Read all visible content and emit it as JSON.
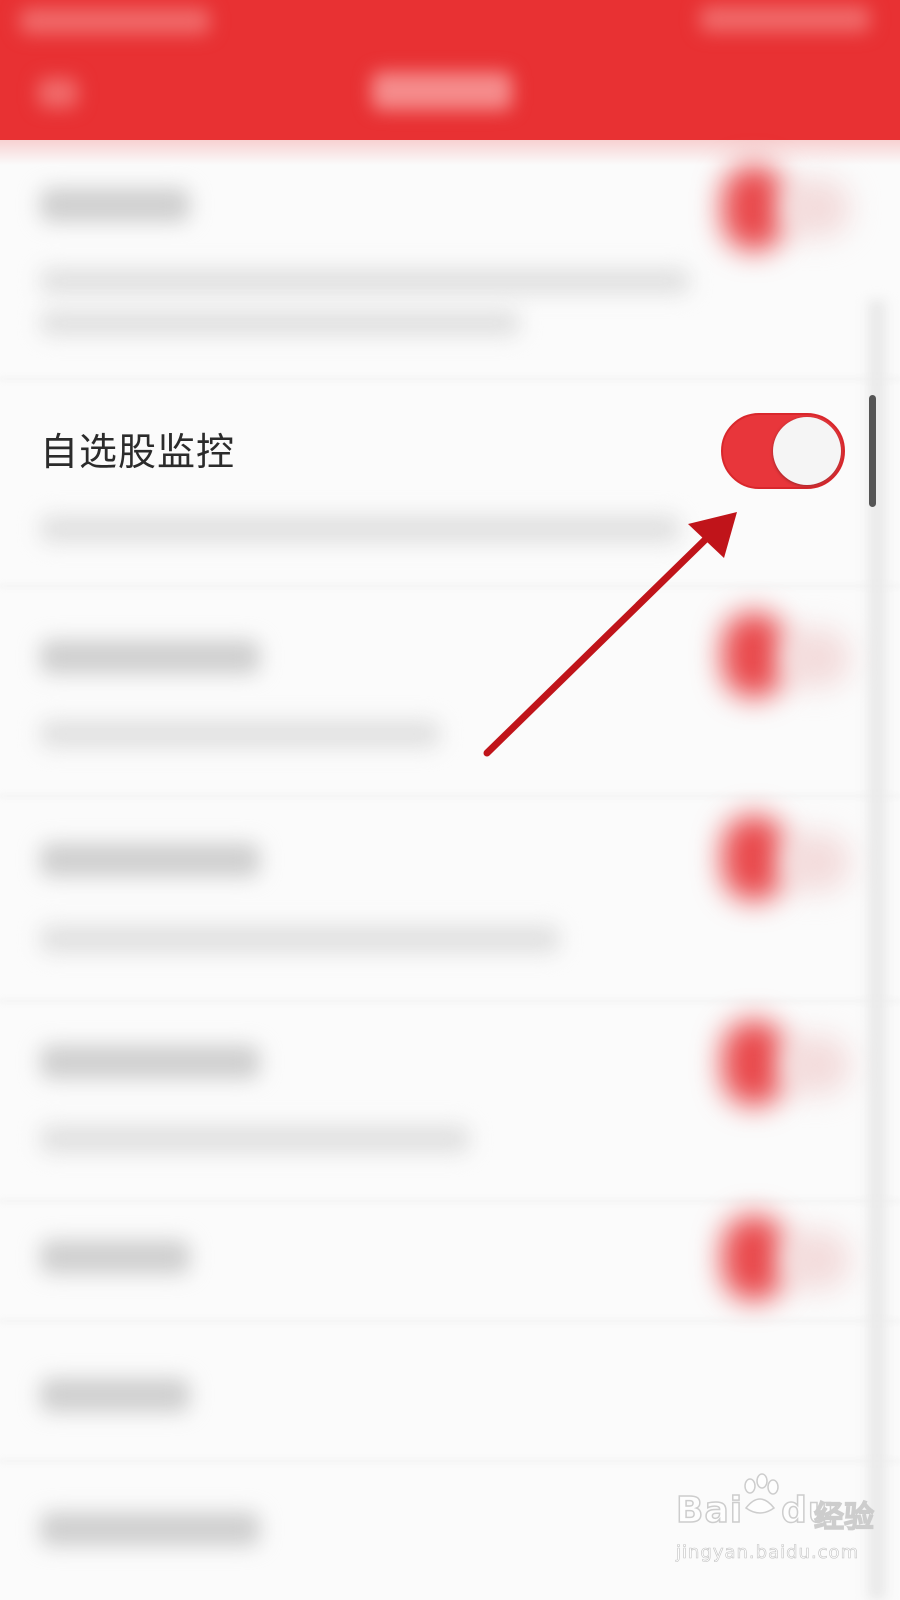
{
  "settings": {
    "focused_item_label": "自选股监控",
    "focused_item_toggle_on": true
  },
  "colors": {
    "header_red": "#e83133",
    "toggle_red": "#e8363b",
    "arrow_red": "#c0141a"
  },
  "watermark": {
    "brand": "Bai",
    "brand_tail": "du",
    "label": "经验",
    "url": "jingyan.baidu.com"
  }
}
